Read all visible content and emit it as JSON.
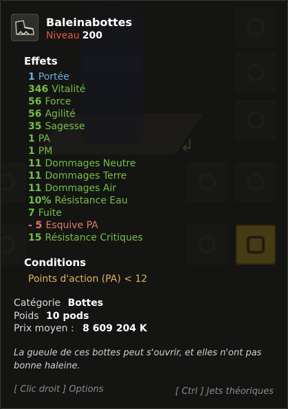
{
  "item": {
    "name": "Baleinabottes",
    "level_label": "Niveau",
    "level": "200",
    "icon": "boots-icon"
  },
  "effects_title": "Effets",
  "effects": [
    {
      "value": "1",
      "label": "Portée",
      "color": "#6ab0e8"
    },
    {
      "value": "346",
      "label": "Vitalité",
      "color": "#73c047"
    },
    {
      "value": "56",
      "label": "Force",
      "color": "#73c047"
    },
    {
      "value": "56",
      "label": "Agilité",
      "color": "#73c047"
    },
    {
      "value": "35",
      "label": "Sagesse",
      "color": "#73c047"
    },
    {
      "value": "1",
      "label": "PA",
      "color": "#73c047"
    },
    {
      "value": "1",
      "label": "PM",
      "color": "#73c047"
    },
    {
      "value": "11",
      "label": "Dommages Neutre",
      "color": "#73c047"
    },
    {
      "value": "11",
      "label": "Dommages Terre",
      "color": "#73c047"
    },
    {
      "value": "11",
      "label": "Dommages Air",
      "color": "#73c047"
    },
    {
      "value": "10%",
      "label": "Résistance Eau",
      "color": "#73c047"
    },
    {
      "value": "7",
      "label": "Fuite",
      "color": "#73c047"
    },
    {
      "value": "- 5",
      "label": "Esquive PA",
      "color": "#e37a6a"
    },
    {
      "value": "15",
      "label": "Résistance Critiques",
      "color": "#73c047"
    }
  ],
  "conditions_title": "Conditions",
  "condition": "Points d'action (PA) < 12",
  "info": {
    "category_label": "Catégorie",
    "category": "Bottes",
    "weight_label": "Poids",
    "weight": "10 pods",
    "price_label": "Prix moyen :",
    "price": "8 609 204 K"
  },
  "description": "La gueule de ces bottes peut s'ouvrir, et elles n'ont pas bonne haleine.",
  "hints": {
    "right_click": "[ Clic droit ] Options",
    "ctrl": "[ Ctrl ] Jets théoriques"
  },
  "colors": {
    "title": "#ffffff",
    "level_label": "#e05a3e",
    "condition": "#e0b560",
    "active_slot": "#c9a41d"
  }
}
